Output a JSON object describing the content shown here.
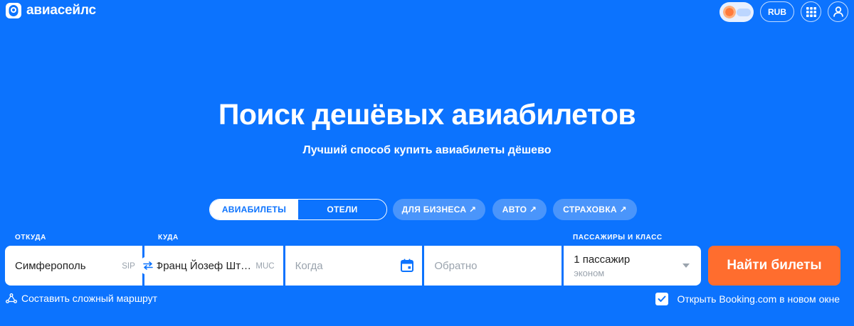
{
  "colors": {
    "brand_blue": "#0C73FE",
    "search_orange": "#FF6D2E",
    "pill_blue": "#4A95FB"
  },
  "header": {
    "logo_text": "авиасейлс",
    "currency": "RUB",
    "icons": [
      "theme-toggle-icon",
      "apps-grid-icon",
      "user-icon"
    ]
  },
  "hero": {
    "title": "Поиск дешёвых авиабилетов",
    "subtitle": "Лучший способ купить авиабилеты дёшево"
  },
  "tabs": {
    "items": [
      {
        "label": "АВИАБИЛЕТЫ",
        "active": true
      },
      {
        "label": "ОТЕЛИ",
        "active": false
      }
    ],
    "links": [
      {
        "label": "ДЛЯ БИЗНЕСА ↗"
      },
      {
        "label": "АВТО ↗"
      },
      {
        "label": "СТРАХОВКА ↗"
      }
    ]
  },
  "search": {
    "from": {
      "label": "ОТКУДА",
      "value": "Симферополь",
      "iata": "SIP"
    },
    "to": {
      "label": "КУДА",
      "value": "Франц Йозеф Шт…",
      "iata": "MUC"
    },
    "depart": {
      "placeholder": "Когда"
    },
    "return": {
      "placeholder": "Обратно"
    },
    "passengers": {
      "label": "ПАССАЖИРЫ И КЛАСС",
      "value": "1 пассажир",
      "class": "эконом"
    },
    "submit_label": "Найти билеты"
  },
  "footer": {
    "complex_route": "Составить сложный маршрут",
    "booking": {
      "label": "Открыть Booking.com в новом окне",
      "checked": true
    }
  }
}
